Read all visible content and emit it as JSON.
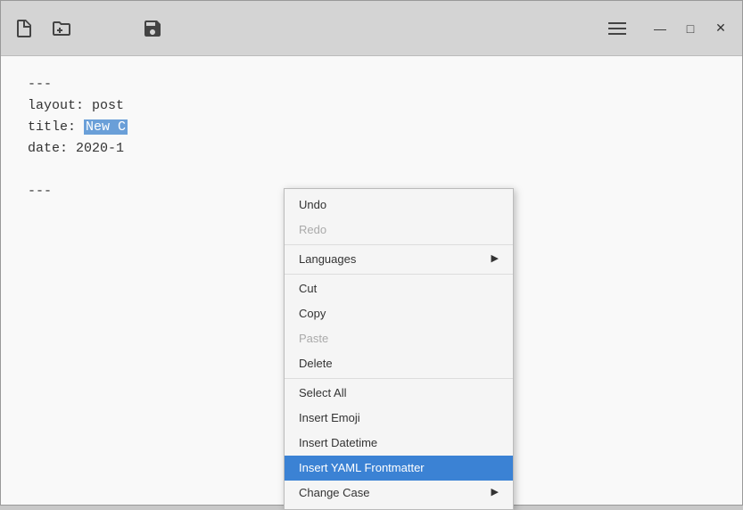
{
  "titlebar": {
    "icons": [
      {
        "name": "new-file-icon",
        "label": "New File"
      },
      {
        "name": "open-file-icon",
        "label": "Open File"
      },
      {
        "name": "save-file-icon",
        "label": "Save File"
      }
    ],
    "menu_icon_label": "Menu",
    "window_controls": {
      "minimize": "—",
      "maximize": "□",
      "close": "✕"
    }
  },
  "editor": {
    "lines": [
      "---",
      "layout: post",
      "title: ",
      "date: 2020-1",
      "",
      "---"
    ],
    "selected_text": "New C",
    "title_prefix": "title: ",
    "date_prefix": "date: 2020-1"
  },
  "context_menu": {
    "items": [
      {
        "id": "undo",
        "label": "Undo",
        "disabled": false,
        "has_arrow": false
      },
      {
        "id": "redo",
        "label": "Redo",
        "disabled": true,
        "has_arrow": false
      },
      {
        "id": "sep1",
        "type": "separator"
      },
      {
        "id": "languages",
        "label": "Languages",
        "disabled": false,
        "has_arrow": true
      },
      {
        "id": "sep2",
        "type": "separator"
      },
      {
        "id": "cut",
        "label": "Cut",
        "disabled": false,
        "has_arrow": false
      },
      {
        "id": "copy",
        "label": "Copy",
        "disabled": false,
        "has_arrow": false
      },
      {
        "id": "paste",
        "label": "Paste",
        "disabled": true,
        "has_arrow": false
      },
      {
        "id": "delete",
        "label": "Delete",
        "disabled": false,
        "has_arrow": false
      },
      {
        "id": "sep3",
        "type": "separator"
      },
      {
        "id": "select-all",
        "label": "Select All",
        "disabled": false,
        "has_arrow": false
      },
      {
        "id": "insert-emoji",
        "label": "Insert Emoji",
        "disabled": false,
        "has_arrow": false
      },
      {
        "id": "insert-datetime",
        "label": "Insert Datetime",
        "disabled": false,
        "has_arrow": false
      },
      {
        "id": "insert-yaml",
        "label": "Insert YAML Frontmatter",
        "disabled": false,
        "has_arrow": false,
        "active": true
      },
      {
        "id": "change-case",
        "label": "Change Case",
        "disabled": false,
        "has_arrow": true
      }
    ]
  }
}
